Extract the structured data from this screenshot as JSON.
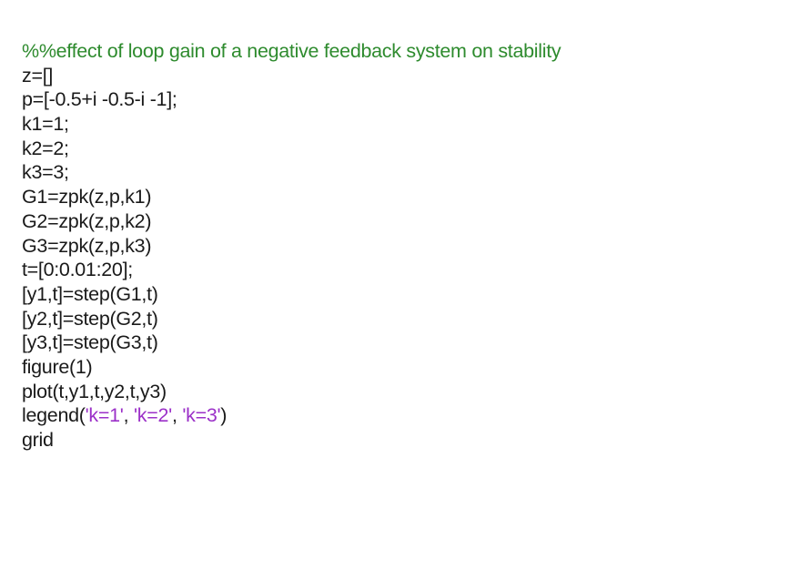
{
  "colors": {
    "comment": "#2e8b2e",
    "string": "#9b30c8",
    "text": "#1a1a1a",
    "background": "#ffffff"
  },
  "code": {
    "line_01": "%%effect of loop gain of a negative feedback system on stability",
    "line_02": "z=[]",
    "line_03": "p=[-0.5+i -0.5-i -1];",
    "line_04": "k1=1;",
    "line_05": "k2=2;",
    "line_06": "k3=3;",
    "line_07": "G1=zpk(z,p,k1)",
    "line_08": "G2=zpk(z,p,k2)",
    "line_09": "G3=zpk(z,p,k3)",
    "line_10": "t=[0:0.01:20];",
    "line_11": "[y1,t]=step(G1,t)",
    "line_12": "[y2,t]=step(G2,t)",
    "line_13": "[y3,t]=step(G3,t)",
    "line_14": "figure(1)",
    "line_15": "plot(t,y1,t,y2,t,y3)",
    "line_16": {
      "prefix": "legend(",
      "str1": "'k=1'",
      "sep1": ", ",
      "str2": "'k=2'",
      "sep2": ", ",
      "str3": "'k=3'",
      "suffix": ")"
    },
    "line_17": "grid"
  }
}
